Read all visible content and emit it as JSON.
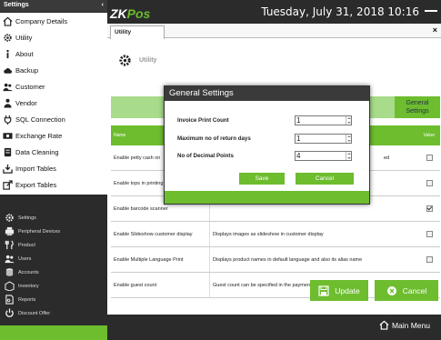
{
  "sidebar": {
    "title": "Settings",
    "collapse": "‹",
    "items": [
      {
        "label": "Company Details",
        "icon": "home-icon"
      },
      {
        "label": "Utility",
        "icon": "gear-icon"
      },
      {
        "label": "About",
        "icon": "info-icon"
      },
      {
        "label": "Backup",
        "icon": "cloud-icon"
      },
      {
        "label": "Customer",
        "icon": "users-icon"
      },
      {
        "label": "Vendor",
        "icon": "vendor-icon"
      },
      {
        "label": "SQL Connection",
        "icon": "plug-icon"
      },
      {
        "label": "Exchange Rate",
        "icon": "money-icon"
      },
      {
        "label": "Data Cleaning",
        "icon": "database-icon"
      },
      {
        "label": "Import Tables",
        "icon": "import-icon"
      },
      {
        "label": "Export Tables",
        "icon": "export-icon"
      }
    ],
    "bottom_items": [
      {
        "label": "Settings",
        "icon": "gear-icon"
      },
      {
        "label": "Peripheral Devices",
        "icon": "printer-icon"
      },
      {
        "label": "Product",
        "icon": "fork-knife-icon"
      },
      {
        "label": "Users",
        "icon": "users-icon"
      },
      {
        "label": "Accounts",
        "icon": "accounts-icon"
      },
      {
        "label": "Inventory",
        "icon": "inventory-icon"
      },
      {
        "label": "Reports",
        "icon": "report-icon"
      },
      {
        "label": "Discount Offer",
        "icon": "power-icon"
      }
    ]
  },
  "header": {
    "logo_a": "ZK",
    "logo_b": "Pos",
    "datetime": "Tuesday, July 31, 2018 10:16"
  },
  "tab": {
    "label": "Utility",
    "close": "×"
  },
  "page": {
    "title": "Utility"
  },
  "general_settings_button": "General Settings",
  "grid": {
    "headers": {
      "name": "Name",
      "value": "Value"
    },
    "rows": [
      {
        "name": "Enable petty cash on",
        "desc": "ed",
        "checked": false
      },
      {
        "name": "Enable tops in printing",
        "desc": "",
        "checked": false
      },
      {
        "name": "Enable barcode scanner",
        "desc": "",
        "checked": true
      },
      {
        "name": "Enable Slideshow customer display",
        "desc": "Displays images as slideshow in customer display",
        "checked": false
      },
      {
        "name": "Enable Multiple Language Print",
        "desc": "Displays product names in  default language and also its alias name",
        "checked": false
      },
      {
        "name": "Enable guest count",
        "desc": "Guest count can be specified in the payment section",
        "checked": false
      }
    ]
  },
  "buttons": {
    "update": "Update",
    "cancel": "Cancel"
  },
  "dialog": {
    "title": "General Settings",
    "fields": [
      {
        "label": "Invoice Print Count",
        "value": "1"
      },
      {
        "label": "Maximum no of return days",
        "value": "1"
      },
      {
        "label": "No of Decimal Points",
        "value": "4"
      }
    ],
    "save": "Save",
    "cancel": "Cancel"
  },
  "status": {
    "main_menu": "Main Menu"
  },
  "colors": {
    "accent": "#6dbd2f",
    "dark": "#2b2b2b",
    "light_green": "#a8dc8a"
  }
}
